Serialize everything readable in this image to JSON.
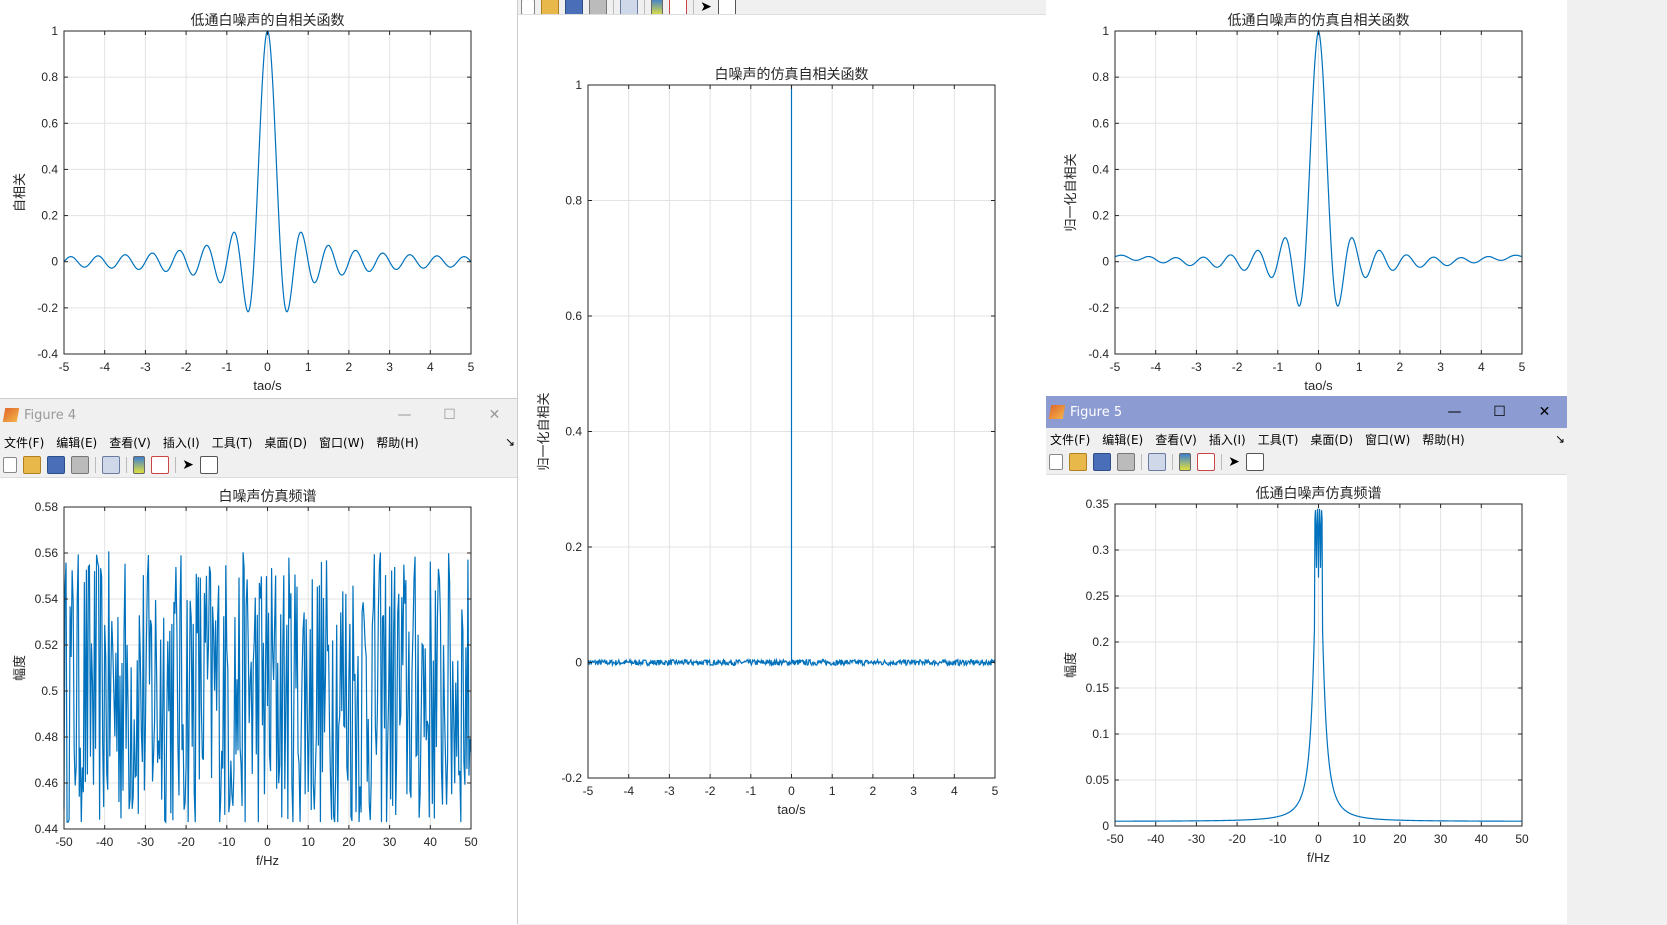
{
  "windows": {
    "figure4": {
      "title": "Figure 4"
    },
    "figure5": {
      "title": "Figure 5"
    }
  },
  "menu": [
    "文件(F)",
    "编辑(E)",
    "查看(V)",
    "插入(I)",
    "工具(T)",
    "桌面(D)",
    "窗口(W)",
    "帮助(H)"
  ],
  "window_controls": {
    "minimize": "—",
    "maximize": "☐",
    "close": "✕"
  },
  "colors": {
    "line": "#0072bd",
    "active_titlebar": "#8c9bd1"
  },
  "toolbar_icons": [
    "new-file-icon",
    "open-folder-icon",
    "save-icon",
    "print-icon",
    "link-plot-icon",
    "colorbar-icon",
    "legend-icon",
    "pointer-icon",
    "property-inspector-icon"
  ],
  "chart_data": [
    {
      "id": "lp_autocorr",
      "type": "line",
      "title": "低通白噪声的自相关函数",
      "xlabel": "tao/s",
      "ylabel": "自相关",
      "xlim": [
        -5,
        5
      ],
      "ylim": [
        -0.4,
        1
      ],
      "xticks": [
        -5,
        -4,
        -3,
        -2,
        -1,
        0,
        1,
        2,
        3,
        4,
        5
      ],
      "yticks": [
        -0.4,
        -0.2,
        0,
        0.2,
        0.4,
        0.6,
        0.8,
        1
      ],
      "grid": true,
      "series": [
        {
          "function": "sinc",
          "bandwidth_hz": 1.5,
          "x_range": [
            -5,
            5
          ],
          "peak": 1
        }
      ]
    },
    {
      "id": "lp_sim_autocorr",
      "type": "line",
      "title": "低通白噪声的仿真自相关函数",
      "xlabel": "tao/s",
      "ylabel": "归一化自相关",
      "xlim": [
        -5,
        5
      ],
      "ylim": [
        -0.4,
        1
      ],
      "xticks": [
        -5,
        -4,
        -3,
        -2,
        -1,
        0,
        1,
        2,
        3,
        4,
        5
      ],
      "yticks": [
        -0.4,
        -0.2,
        0,
        0.2,
        0.4,
        0.6,
        0.8,
        1
      ],
      "grid": true,
      "series": [
        {
          "function": "sinc",
          "bandwidth_hz": 1.5,
          "x_range": [
            -5,
            5
          ],
          "peak": 1,
          "envelope": "decaying",
          "end_value": 0.03
        }
      ]
    },
    {
      "id": "wn_sim_autocorr",
      "type": "line",
      "title": "白噪声的仿真自相关函数",
      "xlabel": "tao/s",
      "ylabel": "归一化自相关",
      "xlim": [
        -5,
        5
      ],
      "ylim": [
        -0.2,
        1
      ],
      "xticks": [
        -5,
        -4,
        -3,
        -2,
        -1,
        0,
        1,
        2,
        3,
        4,
        5
      ],
      "yticks": [
        -0.2,
        0,
        0.2,
        0.4,
        0.6,
        0.8,
        1
      ],
      "grid": true,
      "series": [
        {
          "function": "impulse",
          "x_range": [
            -5,
            5
          ],
          "peak": 1,
          "noise_amplitude": 0.005
        }
      ]
    },
    {
      "id": "wn_spectrum",
      "type": "line",
      "title": "白噪声仿真频谱",
      "xlabel": "f/Hz",
      "ylabel": "幅度",
      "xlim": [
        -50,
        50
      ],
      "ylim": [
        0.44,
        0.58
      ],
      "xticks": [
        -50,
        -40,
        -30,
        -20,
        -10,
        0,
        10,
        20,
        30,
        40,
        50
      ],
      "yticks": [
        0.44,
        0.46,
        0.48,
        0.5,
        0.52,
        0.54,
        0.56,
        0.58
      ],
      "grid": true,
      "series": [
        {
          "function": "noise",
          "x_range": [
            -50,
            50
          ],
          "mean": 0.5,
          "range": [
            0.443,
            0.565
          ],
          "points": 400
        }
      ]
    },
    {
      "id": "lp_spectrum",
      "type": "line",
      "title": "低通白噪声仿真频谱",
      "xlabel": "f/Hz",
      "ylabel": "幅度",
      "xlim": [
        -50,
        50
      ],
      "ylim": [
        0,
        0.35
      ],
      "xticks": [
        -50,
        -40,
        -30,
        -20,
        -10,
        0,
        10,
        20,
        30,
        40,
        50
      ],
      "yticks": [
        0,
        0.05,
        0.1,
        0.15,
        0.2,
        0.25,
        0.3,
        0.35
      ],
      "grid": true,
      "series": [
        {
          "function": "lorentzian",
          "x_range": [
            -50,
            50
          ],
          "peak": 0.345,
          "baseline": 0.005,
          "center_dip": 0.27
        }
      ]
    }
  ]
}
